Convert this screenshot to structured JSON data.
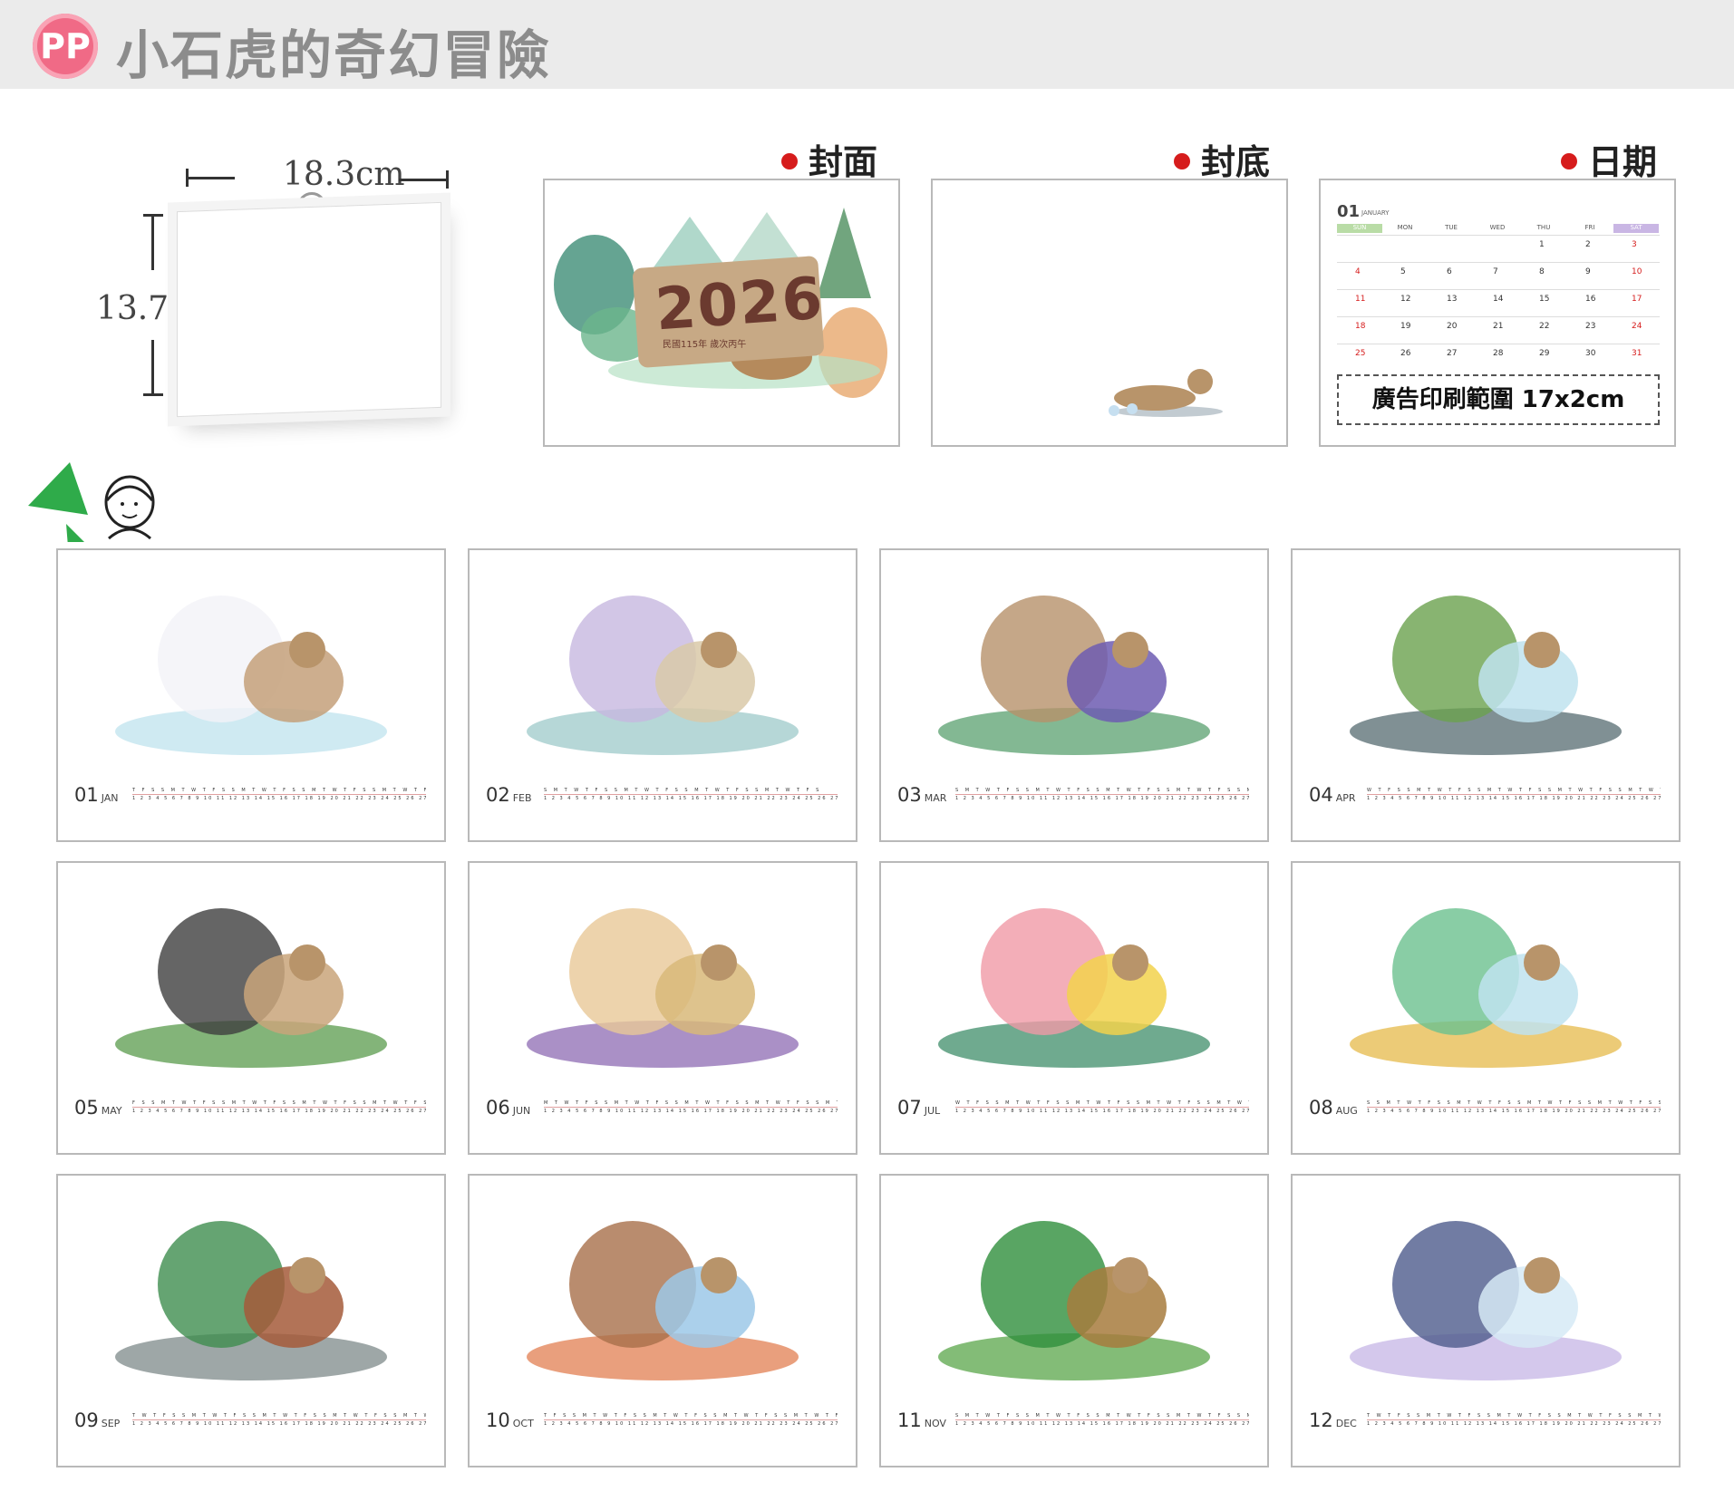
{
  "header": {
    "logo": "PP",
    "title": "小石虎的奇幻冒險"
  },
  "dimensions": {
    "width": "18.3cm",
    "height": "13.7cm"
  },
  "views": [
    {
      "label": "封面"
    },
    {
      "label": "封底"
    },
    {
      "label": "日期"
    }
  ],
  "cover": {
    "year": "2026",
    "subtitle": "民國115年 歲次丙午"
  },
  "sample_page": {
    "month_num": "01",
    "month_name": "JANUARY",
    "weekdays": [
      "SUN",
      "MON",
      "TUE",
      "WED",
      "THU",
      "FRI",
      "SAT"
    ],
    "rows": [
      [
        "",
        "",
        "",
        "",
        "1",
        "2",
        "3"
      ],
      [
        "4",
        "5",
        "6",
        "7",
        "8",
        "9",
        "10"
      ],
      [
        "11",
        "12",
        "13",
        "14",
        "15",
        "16",
        "17"
      ],
      [
        "18",
        "19",
        "20",
        "21",
        "22",
        "23",
        "24"
      ],
      [
        "25",
        "26",
        "27",
        "28",
        "29",
        "30",
        "31"
      ]
    ],
    "ad_text": "廣告印刷範圍 17x2cm"
  },
  "months": [
    {
      "num": "01",
      "abbr": "JAN",
      "days": "T F S S M T W T F S S M T W T F S S M T W T F S S M T W T F S",
      "dates": "1 2 3 4 5 6 7 8 9 10 11 12 13 14 15 16 17 18 19 20 21 22 23 24 25 26 27 28 29 30 31"
    },
    {
      "num": "02",
      "abbr": "FEB",
      "days": "S M T W T F S S M T W T F S S M T W T F S S M T W T F S",
      "dates": "1 2 3 4 5 6 7 8 9 10 11 12 13 14 15 16 17 18 19 20 21 22 23 24 25 26 27 28"
    },
    {
      "num": "03",
      "abbr": "MAR",
      "days": "S M T W T F S S M T W T F S S M T W T F S S M T W T F S S M T",
      "dates": "1 2 3 4 5 6 7 8 9 10 11 12 13 14 15 16 17 18 19 20 21 22 23 24 25 26 27 28 29 30 31"
    },
    {
      "num": "04",
      "abbr": "APR",
      "days": "W T F S S M T W T F S S M T W T F S S M T W T F S S M T W T",
      "dates": "1 2 3 4 5 6 7 8 9 10 11 12 13 14 15 16 17 18 19 20 21 22 23 24 25 26 27 28 29 30"
    },
    {
      "num": "05",
      "abbr": "MAY",
      "days": "F S S M T W T F S S M T W T F S S M T W T F S S M T W T F S S",
      "dates": "1 2 3 4 5 6 7 8 9 10 11 12 13 14 15 16 17 18 19 20 21 22 23 24 25 26 27 28 29 30 31"
    },
    {
      "num": "06",
      "abbr": "JUN",
      "days": "M T W T F S S M T W T F S S M T W T F S S M T W T F S S M T",
      "dates": "1 2 3 4 5 6 7 8 9 10 11 12 13 14 15 16 17 18 19 20 21 22 23 24 25 26 27 28 29 30"
    },
    {
      "num": "07",
      "abbr": "JUL",
      "days": "W T F S S M T W T F S S M T W T F S S M T W T F S S M T W T F",
      "dates": "1 2 3 4 5 6 7 8 9 10 11 12 13 14 15 16 17 18 19 20 21 22 23 24 25 26 27 28 29 30 31"
    },
    {
      "num": "08",
      "abbr": "AUG",
      "days": "S S M T W T F S S M T W T F S S M T W T F S S M T W T F S S M",
      "dates": "1 2 3 4 5 6 7 8 9 10 11 12 13 14 15 16 17 18 19 20 21 22 23 24 25 26 27 28 29 30 31"
    },
    {
      "num": "09",
      "abbr": "SEP",
      "days": "T W T F S S M T W T F S S M T W T F S S M T W T F S S M T W",
      "dates": "1 2 3 4 5 6 7 8 9 10 11 12 13 14 15 16 17 18 19 20 21 22 23 24 25 26 27 28 29 30"
    },
    {
      "num": "10",
      "abbr": "OCT",
      "days": "T F S S M T W T F S S M T W T F S S M T W T F S S M T W T F S",
      "dates": "1 2 3 4 5 6 7 8 9 10 11 12 13 14 15 16 17 18 19 20 21 22 23 24 25 26 27 28 29 30 31"
    },
    {
      "num": "11",
      "abbr": "NOV",
      "days": "S M T W T F S S M T W T F S S M T W T F S S M T W T F S S M",
      "dates": "1 2 3 4 5 6 7 8 9 10 11 12 13 14 15 16 17 18 19 20 21 22 23 24 25 26 27 28 29 30"
    },
    {
      "num": "12",
      "abbr": "DEC",
      "days": "T W T F S S M T W T F S S M T W T F S S M T W T F S S M T W T",
      "dates": "1 2 3 4 5 6 7 8 9 10 11 12 13 14 15 16 17 18 19 20 21 22 23 24 25 26 27 28 29 30 31"
    }
  ]
}
